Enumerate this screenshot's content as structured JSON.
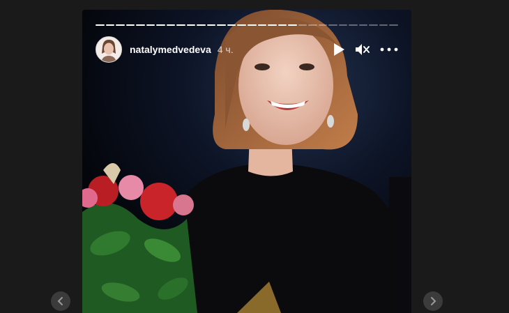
{
  "story": {
    "progress_segments": 30,
    "progress_done": 20,
    "username": "natalymedvedeva",
    "time": "4 ч."
  },
  "icons": {
    "play": "play-icon",
    "mute": "mute-icon",
    "more": "more-options-icon",
    "prev": "chevron-left-icon",
    "next": "chevron-right-icon"
  },
  "colors": {
    "background": "#1a1a1a",
    "text": "#ffffff"
  }
}
